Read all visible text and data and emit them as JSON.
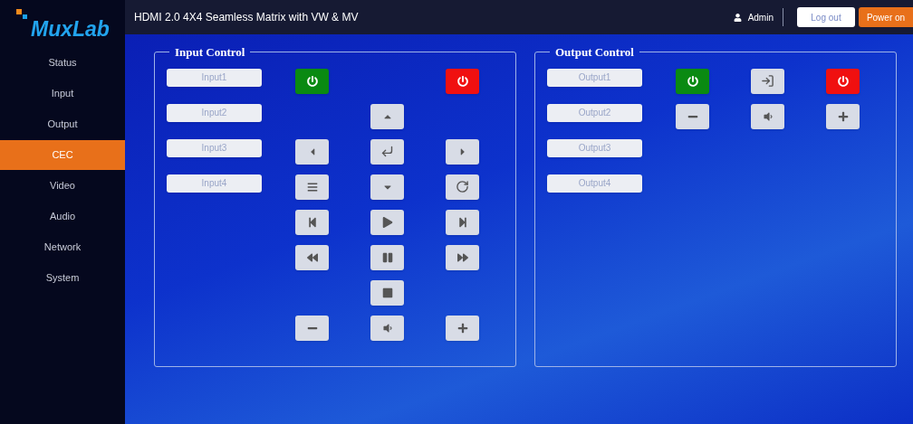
{
  "sidebar": {
    "logo": "MuxLab",
    "items": [
      {
        "label": "Status",
        "selected": false
      },
      {
        "label": "Input",
        "selected": false
      },
      {
        "label": "Output",
        "selected": false
      },
      {
        "label": "CEC",
        "selected": true
      },
      {
        "label": "Video",
        "selected": false
      },
      {
        "label": "Audio",
        "selected": false
      },
      {
        "label": "Network",
        "selected": false
      },
      {
        "label": "System",
        "selected": false
      }
    ]
  },
  "header": {
    "title": "HDMI 2.0 4X4 Seamless Matrix with VW & MV",
    "user": "Admin",
    "logout": "Log out",
    "power": "Power on"
  },
  "input_control": {
    "title": "Input Control",
    "sources": [
      "Input1",
      "Input2",
      "Input3",
      "Input4"
    ]
  },
  "output_control": {
    "title": "Output Control",
    "sources": [
      "Output1",
      "Output2",
      "Output3",
      "Output4"
    ]
  }
}
